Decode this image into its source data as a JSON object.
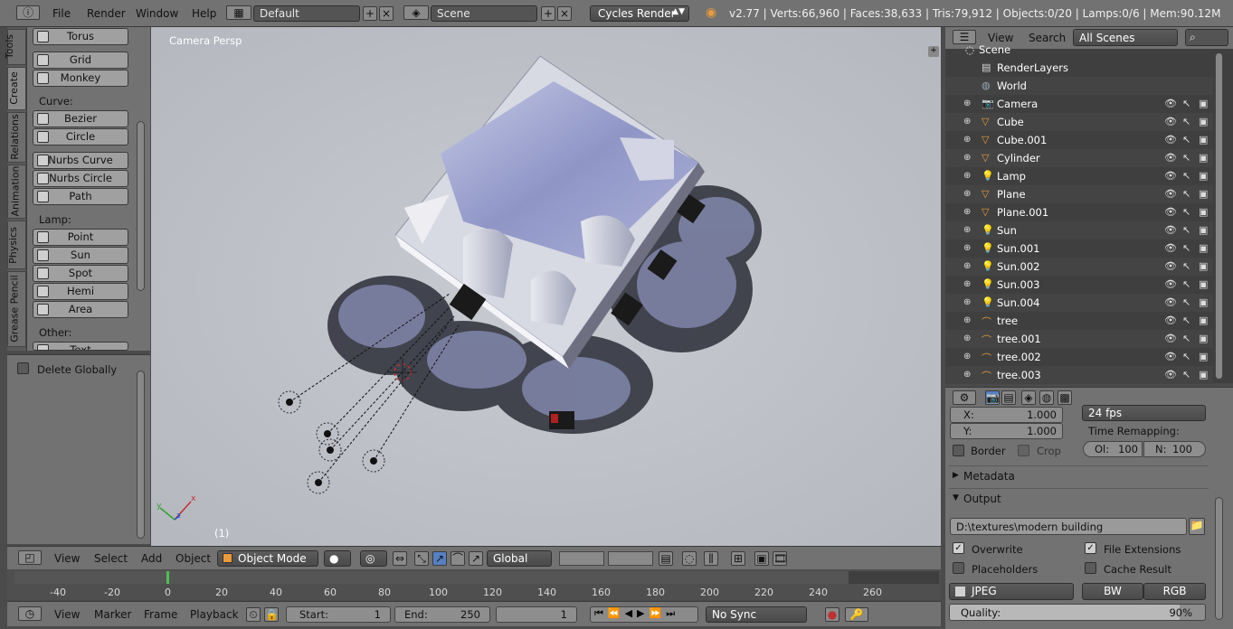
{
  "topbar": {
    "menus": [
      "File",
      "Render",
      "Window",
      "Help"
    ],
    "layout": "Default",
    "scene": "Scene",
    "engine": "Cycles Render",
    "stats": "v2.77 | Verts:66,960 | Faces:38,633 | Tris:79,912 | Objects:0/20 | Lamps:0/6 | Mem:90.12M"
  },
  "toolshelf": {
    "tabs": [
      "Tools",
      "Create",
      "Relations",
      "Animation",
      "Physics",
      "Grease Pencil"
    ],
    "active_tab": "Create",
    "buttons_top": [
      "Torus",
      "Grid",
      "Monkey"
    ],
    "curve_label": "Curve:",
    "curve_buttons": [
      "Bezier",
      "Circle",
      "Nurbs Curve",
      "Nurbs Circle",
      "Path"
    ],
    "lamp_label": "Lamp:",
    "lamp_buttons": [
      "Point",
      "Sun",
      "Spot",
      "Hemi",
      "Area"
    ],
    "other_label": "Other:",
    "other_buttons": [
      "Text"
    ],
    "delete_globally": "Delete Globally"
  },
  "viewport": {
    "label": "Camera Persp",
    "frame": "(1)"
  },
  "vpheader": {
    "menus": [
      "View",
      "Select",
      "Add",
      "Object"
    ],
    "mode": "Object Mode",
    "orientation": "Global"
  },
  "timeline": {
    "ticks": [
      "-40",
      "-20",
      "0",
      "20",
      "40",
      "60",
      "80",
      "100",
      "120",
      "140",
      "160",
      "180",
      "200",
      "220",
      "240",
      "260"
    ],
    "menus": [
      "View",
      "Marker",
      "Frame",
      "Playback"
    ],
    "start_label": "Start:",
    "start": "1",
    "end_label": "End:",
    "end": "250",
    "current": "1",
    "sync": "No Sync"
  },
  "outliner": {
    "menus": [
      "View",
      "Search"
    ],
    "filter": "All Scenes",
    "scene_root": "Scene",
    "items": [
      {
        "name": "RenderLayers",
        "icon": "renderlayers-icon",
        "color": "#d8d8d8"
      },
      {
        "name": "World",
        "icon": "world-icon",
        "color": "#9aa8b5"
      },
      {
        "name": "Camera",
        "icon": "camera-icon",
        "color": "#e89a3c"
      },
      {
        "name": "Cube",
        "icon": "mesh-icon",
        "color": "#e89a3c"
      },
      {
        "name": "Cube.001",
        "icon": "mesh-icon",
        "color": "#e89a3c"
      },
      {
        "name": "Cylinder",
        "icon": "mesh-icon",
        "color": "#e89a3c"
      },
      {
        "name": "Lamp",
        "icon": "lamp-icon",
        "color": "#e8c23c"
      },
      {
        "name": "Plane",
        "icon": "mesh-icon",
        "color": "#e89a3c"
      },
      {
        "name": "Plane.001",
        "icon": "mesh-icon",
        "color": "#e89a3c"
      },
      {
        "name": "Sun",
        "icon": "lamp-icon",
        "color": "#e8c23c"
      },
      {
        "name": "Sun.001",
        "icon": "lamp-icon",
        "color": "#e8c23c"
      },
      {
        "name": "Sun.002",
        "icon": "lamp-icon",
        "color": "#e8c23c"
      },
      {
        "name": "Sun.003",
        "icon": "lamp-icon",
        "color": "#e8c23c"
      },
      {
        "name": "Sun.004",
        "icon": "lamp-icon",
        "color": "#e8c23c"
      },
      {
        "name": "tree",
        "icon": "curve-icon",
        "color": "#e89a3c"
      },
      {
        "name": "tree.001",
        "icon": "curve-icon",
        "color": "#e89a3c"
      },
      {
        "name": "tree.002",
        "icon": "curve-icon",
        "color": "#e89a3c"
      },
      {
        "name": "tree.003",
        "icon": "curve-icon",
        "color": "#e89a3c"
      }
    ]
  },
  "properties": {
    "x_label": "X:",
    "x_val": "1.000",
    "y_label": "Y:",
    "y_val": "1.000",
    "fps": "24 fps",
    "time_remap": "Time Remapping:",
    "old_label": "Ol:",
    "old_val": "100",
    "new_label": "N:",
    "new_val": "100",
    "border": "Border",
    "crop": "Crop",
    "metadata": "Metadata",
    "output": "Output",
    "path": "D:\\textures\\modern building",
    "overwrite": "Overwrite",
    "file_ext": "File Extensions",
    "placeholders": "Placeholders",
    "cache": "Cache Result",
    "format": "JPEG",
    "bw": "BW",
    "rgb": "RGB",
    "quality_label": "Quality:",
    "quality": "90%"
  }
}
